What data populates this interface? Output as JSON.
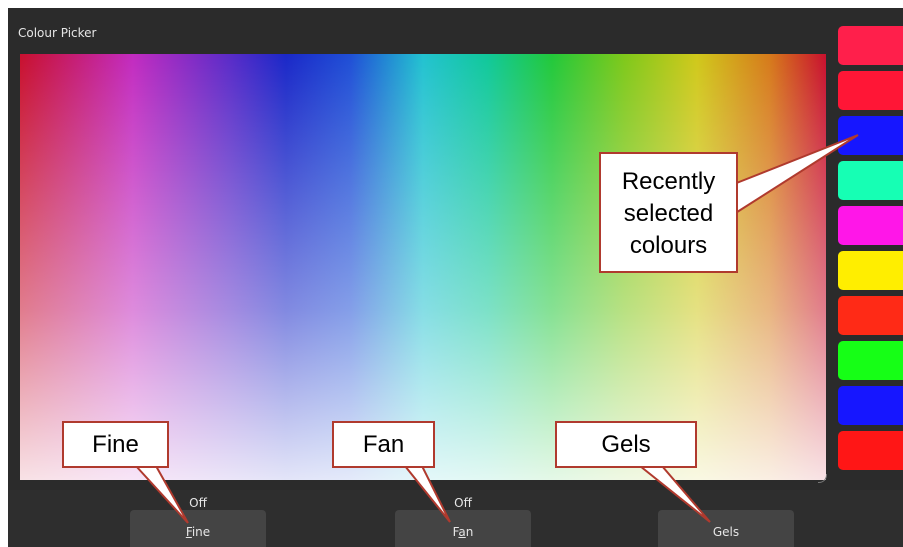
{
  "picker": {
    "title": "Colour Picker"
  },
  "recent_colours": [
    {
      "color": "#ff1f4b"
    },
    {
      "color": "#ff1636"
    },
    {
      "color": "#1616ff"
    },
    {
      "color": "#16ffb4"
    },
    {
      "color": "#ff16e8"
    },
    {
      "color": "#ffee00"
    },
    {
      "color": "#ff2a16"
    },
    {
      "color": "#16ff16"
    },
    {
      "color": "#1616ff"
    },
    {
      "color": "#ff1616"
    }
  ],
  "softkeys": {
    "fine": {
      "state": "Off",
      "label_pre": "",
      "label_ul": "F",
      "label_post": "ine"
    },
    "fan": {
      "state": "Off",
      "label_pre": "F",
      "label_ul": "a",
      "label_post": "n"
    },
    "gels": {
      "label": "Gels"
    }
  },
  "annotations": {
    "recent": {
      "line1": "Recently",
      "line2": "selected",
      "line3": "colours"
    },
    "fine": "Fine",
    "fan": "Fan",
    "gels": "Gels"
  },
  "colors": {
    "callout_border": "#b03a2e",
    "background": "#2b2b2b"
  }
}
